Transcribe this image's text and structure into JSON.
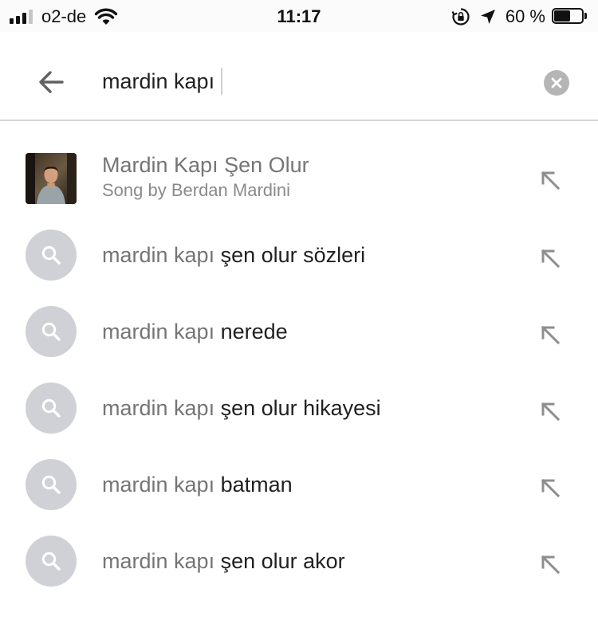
{
  "status_bar": {
    "carrier": "o2-de",
    "time": "11:17",
    "battery_percent_text": "60 %",
    "battery_level": 0.6,
    "signal_bars_filled": 3,
    "signal_bars_total": 4
  },
  "search": {
    "query": "mardin kapı"
  },
  "top_result": {
    "title": "Mardin Kapı Şen Olur",
    "subtitle": "Song by Berdan Mardini"
  },
  "suggestions": [
    {
      "prefix": "mardin kapı",
      "rest": " şen olur sözleri"
    },
    {
      "prefix": "mardin kapı",
      "rest": " nerede"
    },
    {
      "prefix": "mardin kapı",
      "rest": " şen olur hikayesi"
    },
    {
      "prefix": "mardin kapı",
      "rest": " batman"
    },
    {
      "prefix": "mardin kapı",
      "rest": " şen olur akor"
    }
  ],
  "icons": {
    "back": "arrow-left-icon",
    "clear": "close-circle-icon",
    "suggestion": "search-icon",
    "fill": "arrow-up-left-icon"
  },
  "colors": {
    "suggestion_circle": "#cfd1d6",
    "muted_text": "#757575",
    "primary_text": "#212121"
  }
}
